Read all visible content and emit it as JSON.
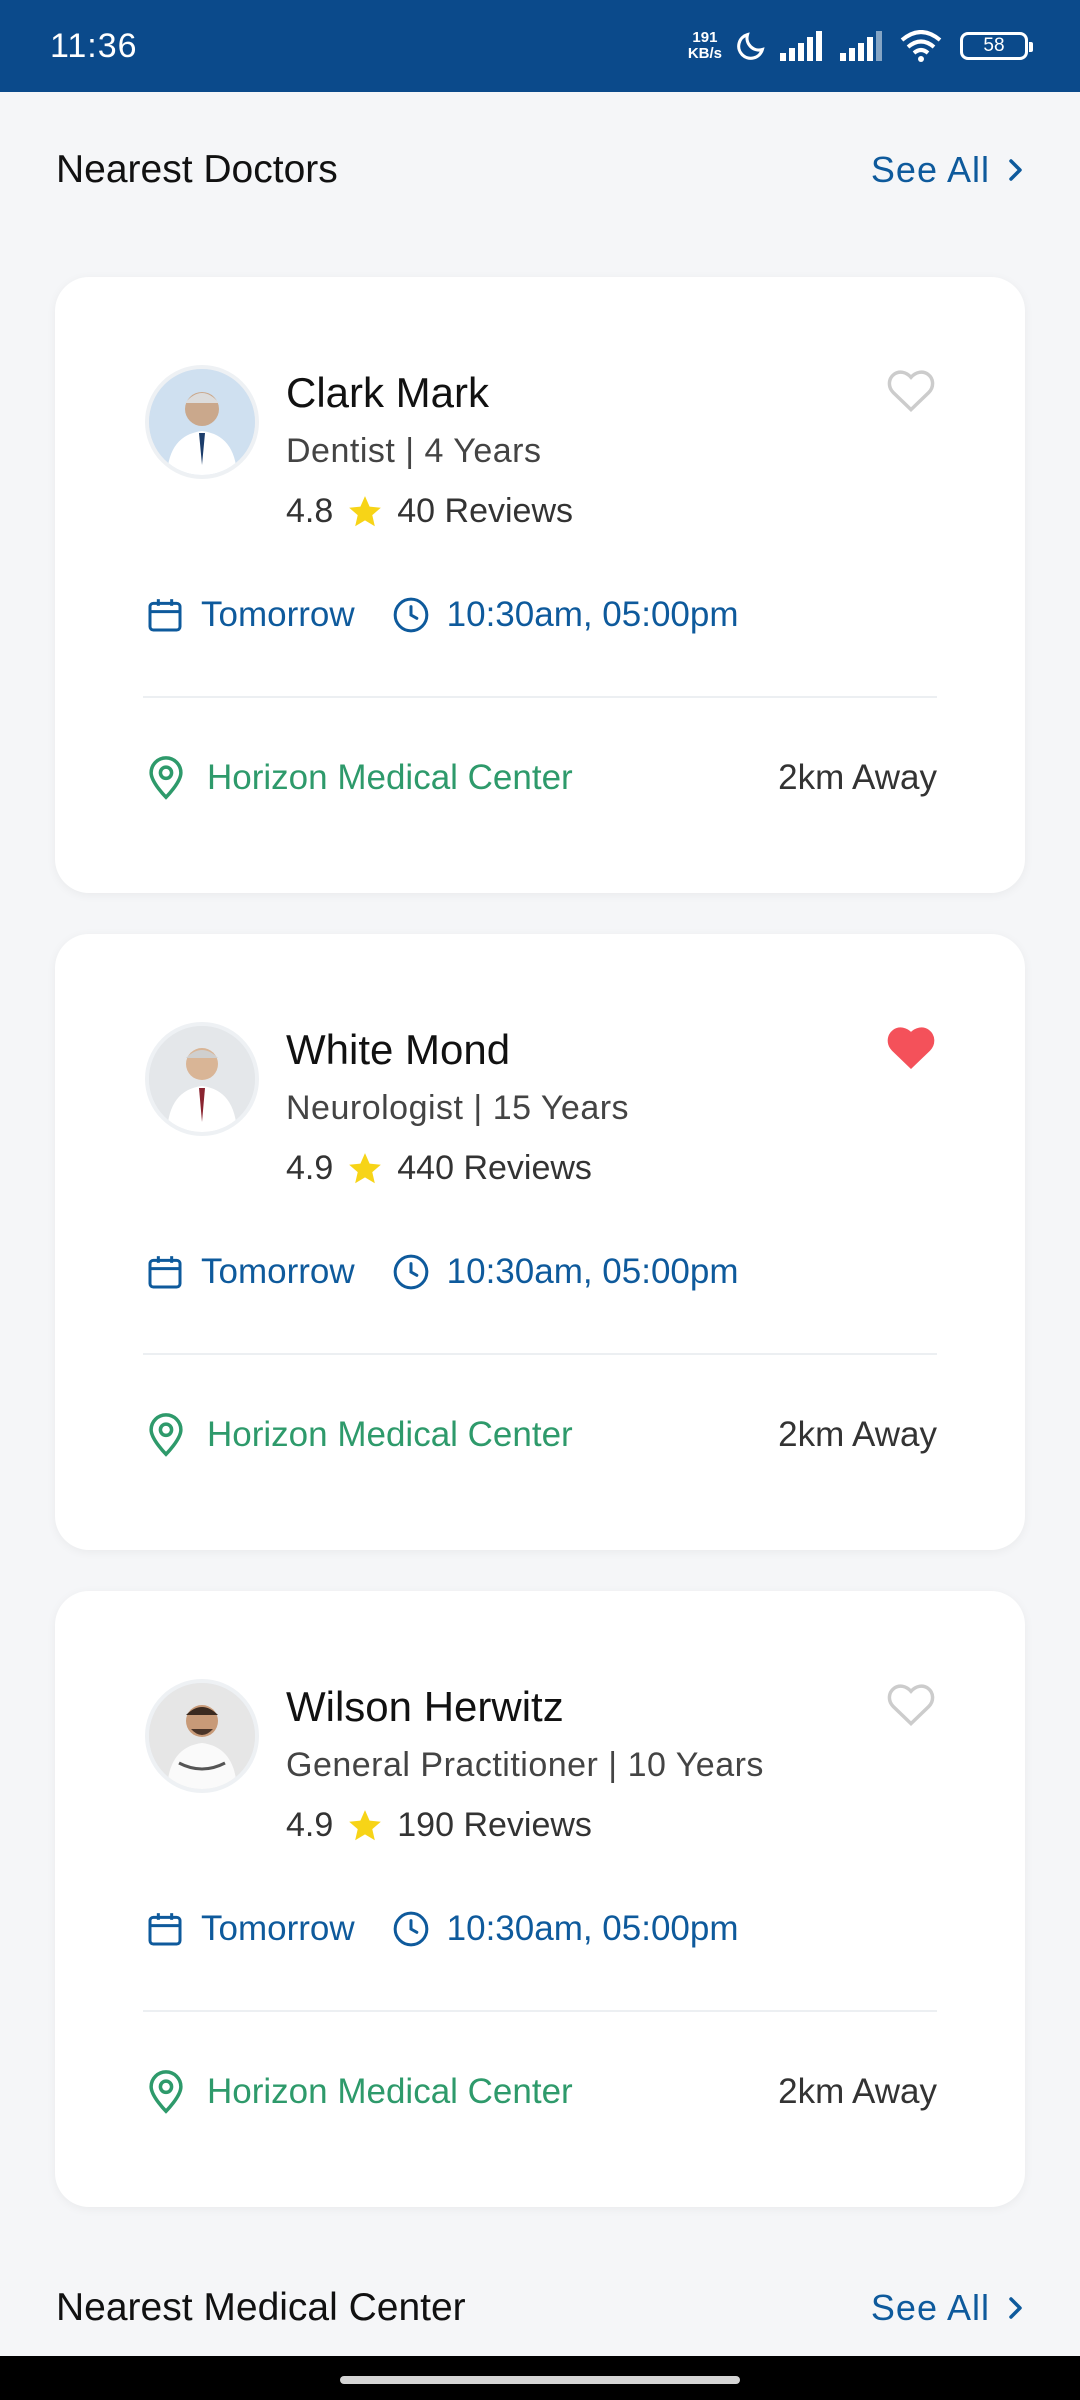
{
  "status_bar": {
    "time": "11:36",
    "net_speed_value": "191",
    "net_speed_unit": "KB/s",
    "battery": "58"
  },
  "nearest_doctors": {
    "title": "Nearest Doctors",
    "see_all": "See All"
  },
  "doctors": [
    {
      "name": "Clark Mark",
      "specialty": "Dentist | 4 Years",
      "rating": "4.8",
      "reviews": "40 Reviews",
      "favorite": false,
      "day": "Tomorrow",
      "times": "10:30am, 05:00pm",
      "center": "Horizon Medical Center",
      "distance": "2km Away"
    },
    {
      "name": "White Mond",
      "specialty": "Neurologist | 15 Years",
      "rating": "4.9",
      "reviews": "440 Reviews",
      "favorite": true,
      "day": "Tomorrow",
      "times": "10:30am, 05:00pm",
      "center": "Horizon Medical Center",
      "distance": "2km Away"
    },
    {
      "name": "Wilson Herwitz",
      "specialty": "General Practitioner | 10 Years",
      "rating": "4.9",
      "reviews": "190 Reviews",
      "favorite": false,
      "day": "Tomorrow",
      "times": "10:30am, 05:00pm",
      "center": "Horizon Medical Center",
      "distance": "2km Away"
    }
  ],
  "nearest_centers": {
    "title": "Nearest Medical Center",
    "see_all": "See All"
  },
  "colors": {
    "brand_blue": "#0b4a8b",
    "link_blue": "#0e5a9c",
    "location_green": "#2e9a6b",
    "heart_red": "#f4515a",
    "star_yellow": "#f7d417"
  },
  "icons": [
    "moon-icon",
    "signal-icon",
    "wifi-icon",
    "battery-icon",
    "chevron-right-icon",
    "heart-icon",
    "star-icon",
    "calendar-icon",
    "clock-icon",
    "location-pin-icon"
  ]
}
